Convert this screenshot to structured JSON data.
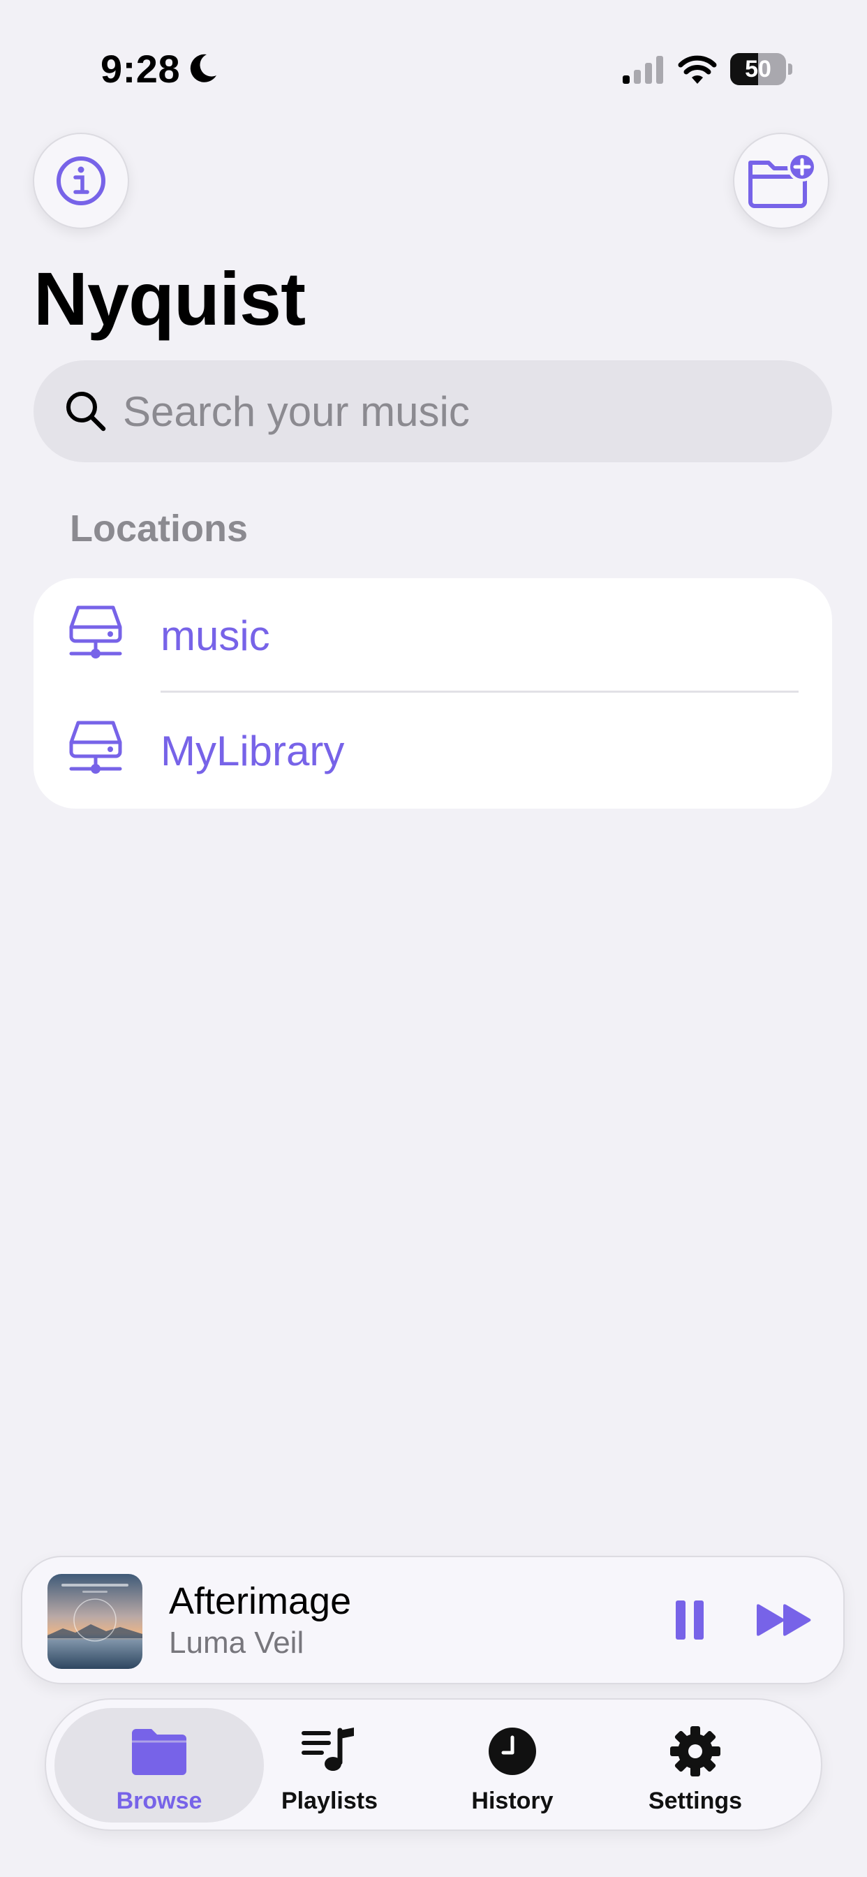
{
  "status_bar": {
    "time": "9:28",
    "battery_level": 50,
    "battery_text": "50",
    "icons": [
      "moon-icon",
      "signal-icon",
      "wifi-icon",
      "battery-icon"
    ]
  },
  "header": {
    "info_icon": "info-circle-icon",
    "add_folder_icon": "folder-plus-icon",
    "title": "Nyquist"
  },
  "search": {
    "placeholder": "Search your music",
    "value": ""
  },
  "locations": {
    "header": "Locations",
    "items": [
      {
        "label": "music",
        "icon": "network-drive-icon"
      },
      {
        "label": "MyLibrary",
        "icon": "network-drive-icon"
      }
    ]
  },
  "now_playing": {
    "title": "Afterimage",
    "artist": "Luma Veil",
    "state": "playing",
    "controls": [
      "pause-icon",
      "fast-forward-icon"
    ]
  },
  "tabs": [
    {
      "label": "Browse",
      "icon": "folder-icon",
      "active": true
    },
    {
      "label": "Playlists",
      "icon": "playlist-icon",
      "active": false
    },
    {
      "label": "History",
      "icon": "clock-icon",
      "active": false
    },
    {
      "label": "Settings",
      "icon": "gear-icon",
      "active": false
    }
  ],
  "colors": {
    "accent": "#7763E8",
    "background": "#F2F1F6",
    "secondary_text": "#8B8A90"
  }
}
